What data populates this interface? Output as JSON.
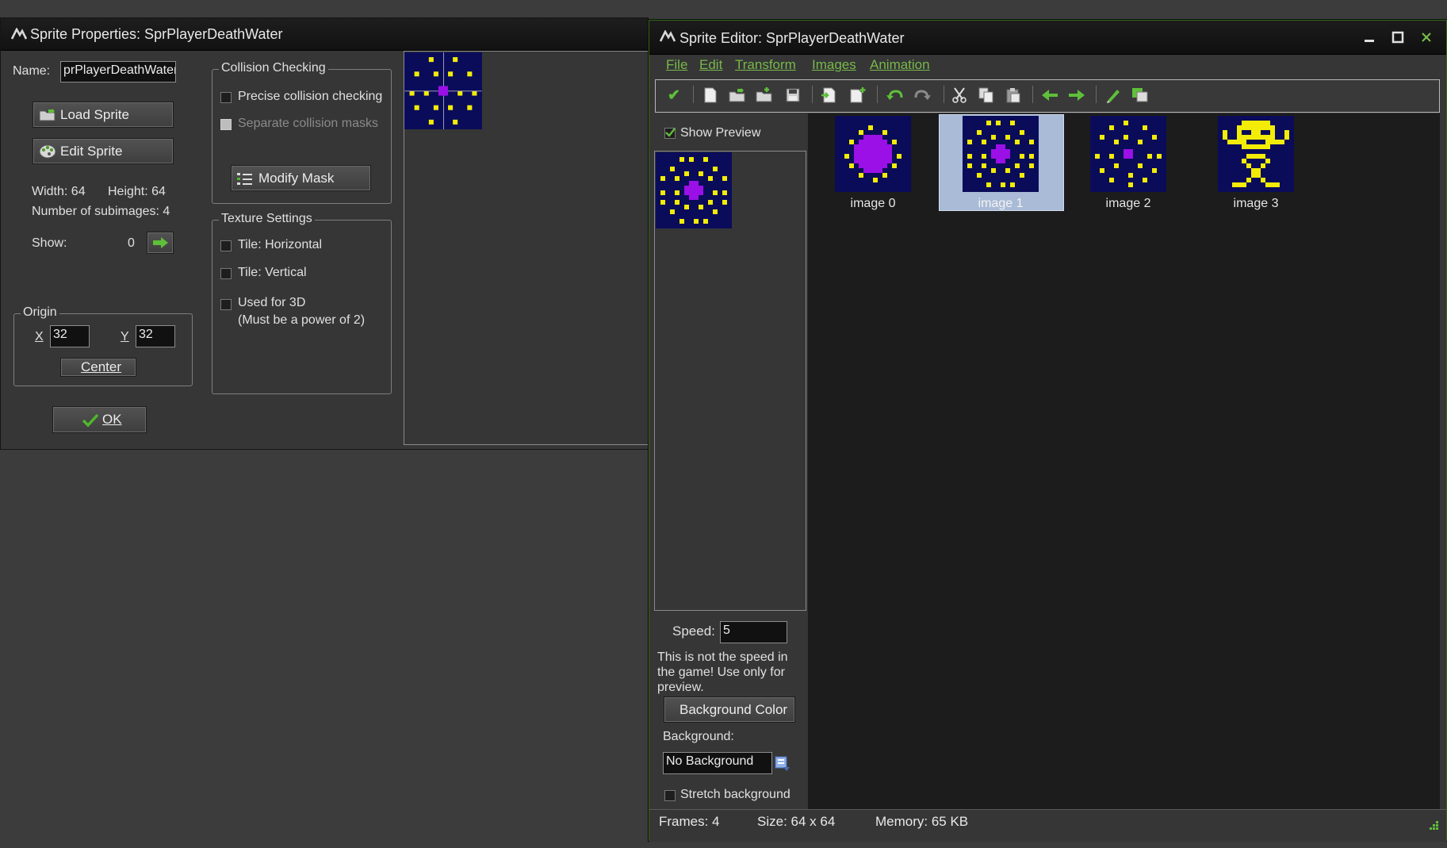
{
  "props": {
    "title": "Sprite Properties: SprPlayerDeathWater",
    "name_label": "Name:",
    "name_value": "prPlayerDeathWater",
    "load_sprite": "Load Sprite",
    "edit_sprite": "Edit Sprite",
    "width_text": "Width: 64",
    "height_text": "Height: 64",
    "subimages_text": "Number of subimages: 4",
    "show_label": "Show:",
    "show_value": "0",
    "origin_label": "Origin",
    "x_label": "X",
    "x_value": "32",
    "y_label": "Y",
    "y_value": "32",
    "center_button": "Center",
    "ok_button": "OK",
    "collision_group": "Collision Checking",
    "precise": "Precise collision checking",
    "separate": "Separate collision masks",
    "modify_mask": "Modify Mask",
    "texture_group": "Texture Settings",
    "tile_h": "Tile: Horizontal",
    "tile_v": "Tile: Vertical",
    "used_3d": "Used for 3D",
    "power2": "(Must be a power of 2)"
  },
  "editor": {
    "title": "Sprite Editor: SprPlayerDeathWater",
    "menu": [
      "File",
      "Edit",
      "Transform",
      "Images",
      "Animation"
    ],
    "toolbar_icons": [
      "confirm-check-icon",
      "new-sprite-icon",
      "open-file-icon",
      "add-from-file-icon",
      "save-icon",
      "insert-empty-image-icon",
      "add-empty-image-icon",
      "undo-icon",
      "redo-icon",
      "cut-icon",
      "copy-icon",
      "paste-icon",
      "shift-left-icon",
      "shift-right-icon",
      "edit-image-icon",
      "paint-icon"
    ],
    "show_preview": "Show Preview",
    "speed_label": "Speed:",
    "speed_value": "5",
    "speed_note": "This is not the speed in the game! Use only for preview.",
    "bg_color_button": "Background Color",
    "background_label": "Background:",
    "background_value": "No Background",
    "stretch_background": "Stretch background",
    "frames": [
      {
        "label": "image 0",
        "kind": "ring-blob"
      },
      {
        "label": "image 1",
        "kind": "double-ring",
        "selected": true
      },
      {
        "label": "image 2",
        "kind": "scattered-dots"
      },
      {
        "label": "image 3",
        "kind": "skull"
      }
    ],
    "status": {
      "frames": "Frames: 4",
      "size": "Size: 64 x 64",
      "memory": "Memory: 65 KB"
    }
  },
  "colors": {
    "accent_green": "#78b84a",
    "sprite_bg": "#0a0c5a",
    "sprite_yellow": "#f2ec08",
    "sprite_purple": "#9a10e6",
    "selection": "#a9bbd6"
  }
}
